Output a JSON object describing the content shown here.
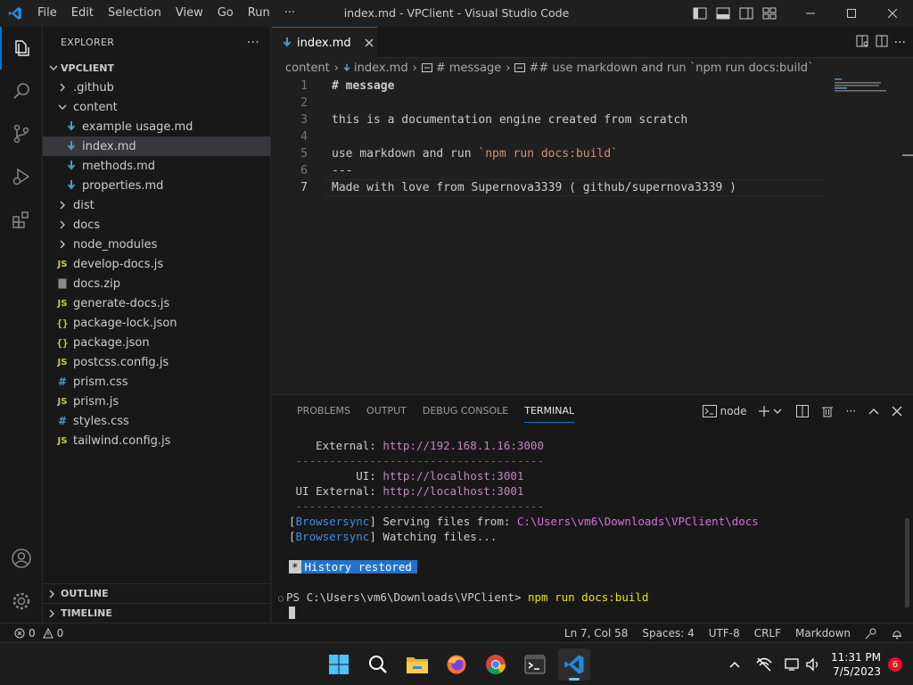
{
  "menu": [
    "File",
    "Edit",
    "Selection",
    "View",
    "Go",
    "Run",
    "···"
  ],
  "window_title": "index.md - VPClient - Visual Studio Code",
  "sidebar": {
    "title": "EXPLORER",
    "more": "···",
    "root": "VPCLIENT",
    "items": [
      {
        "label": ".github",
        "type": "folder",
        "open": false
      },
      {
        "label": "content",
        "type": "folder",
        "open": true
      },
      {
        "label": "example usage.md",
        "type": "md"
      },
      {
        "label": "index.md",
        "type": "md",
        "selected": true
      },
      {
        "label": "methods.md",
        "type": "md"
      },
      {
        "label": "properties.md",
        "type": "md"
      },
      {
        "label": "dist",
        "type": "folder",
        "open": false
      },
      {
        "label": "docs",
        "type": "folder",
        "open": false
      },
      {
        "label": "node_modules",
        "type": "folder",
        "open": false
      },
      {
        "label": "develop-docs.js",
        "type": "js"
      },
      {
        "label": "docs.zip",
        "type": "zip"
      },
      {
        "label": "generate-docs.js",
        "type": "js"
      },
      {
        "label": "package-lock.json",
        "type": "json"
      },
      {
        "label": "package.json",
        "type": "json"
      },
      {
        "label": "postcss.config.js",
        "type": "js"
      },
      {
        "label": "prism.css",
        "type": "css"
      },
      {
        "label": "prism.js",
        "type": "js"
      },
      {
        "label": "styles.css",
        "type": "css"
      },
      {
        "label": "tailwind.config.js",
        "type": "js"
      }
    ],
    "outline": "OUTLINE",
    "timeline": "TIMELINE"
  },
  "tab": {
    "label": "index.md"
  },
  "breadcrumb": [
    "content",
    "index.md",
    "# message",
    "## use markdown and run `npm run docs:build`"
  ],
  "editor": {
    "lines": [
      {
        "n": "1",
        "text": "# message"
      },
      {
        "n": "2",
        "text": ""
      },
      {
        "n": "3",
        "text": "this is a documentation engine created from scratch"
      },
      {
        "n": "4",
        "text": ""
      },
      {
        "n": "5",
        "pre": "use markdown and run ",
        "code": "`npm run docs:build`"
      },
      {
        "n": "6",
        "text": "---"
      },
      {
        "n": "7",
        "text": "Made with love from Supernova3339 ( github/supernova3339 )"
      }
    ]
  },
  "panel": {
    "tabs": [
      "PROBLEMS",
      "OUTPUT",
      "DEBUG CONSOLE",
      "TERMINAL"
    ],
    "active_tab": "TERMINAL",
    "terminal_name": "node",
    "terminal": {
      "external_label": "    External: ",
      "external_url": "http://192.168.1.16:3000",
      "divider1": " -------------------------------------",
      "ui_label": "          UI: ",
      "ui_url": "http://localhost:3001",
      "ui_ext_label": " UI External: ",
      "ui_ext_url": "http://localhost:3001",
      "divider2": " -------------------------------------",
      "bs_tag": "Browsersync",
      "serving_text": " Serving files from: ",
      "serving_path": "C:\\Users\\vm6\\Downloads\\VPClient\\docs",
      "watching_text": " Watching files...",
      "history_star": "*",
      "history_text": "History restored",
      "prompt_dot": "○",
      "prompt": "PS C:\\Users\\vm6\\Downloads\\VPClient> ",
      "command": "npm run docs:build"
    }
  },
  "status": {
    "errors": "0",
    "warnings": "0",
    "position": "Ln 7, Col 58",
    "spaces": "Spaces: 4",
    "encoding": "UTF-8",
    "eol": "CRLF",
    "language": "Markdown"
  },
  "taskbar": {
    "time": "11:31 PM",
    "date": "7/5/2023",
    "notifications": "6"
  },
  "colors": {
    "accent": "#0078d4",
    "vscode_blue": "#2489db",
    "md_folder": "#519aba",
    "js": "#cbcb41",
    "json": "#cbcb41",
    "css": "#519aba"
  }
}
